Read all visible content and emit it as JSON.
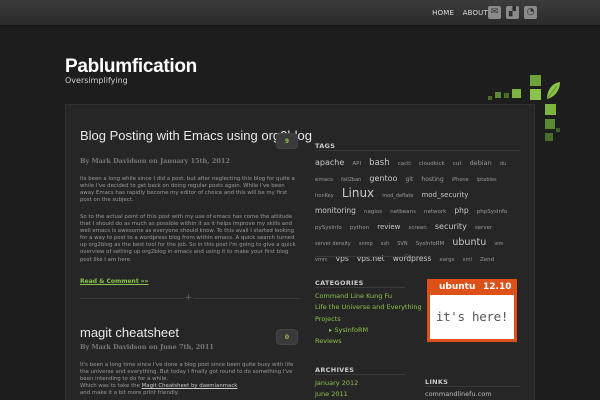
{
  "nav": {
    "home": "HOME",
    "about": "ABOUT"
  },
  "site": {
    "title": "Pablumfication",
    "tagline": "Oversimplifying"
  },
  "posts": [
    {
      "title": "Blog Posting with Emacs using org2blog",
      "meta": "By Mark Davidson on January 15th, 2012",
      "comments": "9",
      "paragraphs": [
        "Its been a long while since I did a post, but after neglecting this blog for quite a while I've decided to get back on doing regular posts again. While I've been away Emacs has rapidly become my editor of choice and this will be my first post on the subject.",
        "So to the actual point of this post with my use of emacs has come the attitude that I should do as much as possible within it as it helps improve my skills and well emacs is awesome as everyone should know. To this avail I started looking for a way to post to a wordpress blog from within emacs. A quick search turned up org2blog as the best tool for the job. So in this post I'm going to give a quick overview of setting up org2blog in emacs and using it to make your first blog post like I am here."
      ],
      "read_more": "Read & Comment »»"
    },
    {
      "title": "magit cheatsheet",
      "meta": "By Mark Davidson on June 7th, 2011",
      "comments": "0",
      "paragraph": "It's been a long time since I've done a blog post since been quite busy with life the universe and everything. But today I finally got round to do something I've been intending to do for a while.",
      "line2_prefix": "Which was to take the ",
      "line2_link": "Magit Cheatsheet by daemianmack",
      "line3": "and make it a bit more print friendly."
    }
  ],
  "sidebar": {
    "tags_heading": "TAGS",
    "tags": [
      {
        "t": "apache",
        "s": 8
      },
      {
        "t": "API",
        "s": 5.5
      },
      {
        "t": "bash",
        "s": 8.5
      },
      {
        "t": "cacti",
        "s": 5.5
      },
      {
        "t": "cloudkick",
        "s": 5.5
      },
      {
        "t": "cut",
        "s": 5.5
      },
      {
        "t": "debian",
        "s": 6.5
      },
      {
        "t": "du",
        "s": 5
      },
      {
        "t": "emacs",
        "s": 5.5
      },
      {
        "t": "fail2ban",
        "s": 5
      },
      {
        "t": "gentoo",
        "s": 8
      },
      {
        "t": "git",
        "s": 6
      },
      {
        "t": "hosting",
        "s": 6
      },
      {
        "t": "iPhone",
        "s": 5
      },
      {
        "t": "iptables",
        "s": 5
      },
      {
        "t": "IronKey",
        "s": 5
      },
      {
        "t": "Linux",
        "s": 12
      },
      {
        "t": "mod_deflate",
        "s": 5
      },
      {
        "t": "mod_security",
        "s": 7
      },
      {
        "t": "monitoring",
        "s": 7.5
      },
      {
        "t": "nagios",
        "s": 5.5
      },
      {
        "t": "netbeans",
        "s": 5.5
      },
      {
        "t": "network",
        "s": 5.5
      },
      {
        "t": "php",
        "s": 7.5
      },
      {
        "t": "phpSysInfo",
        "s": 5.5
      },
      {
        "t": "pySysInfo",
        "s": 5.5
      },
      {
        "t": "python",
        "s": 5.5
      },
      {
        "t": "review",
        "s": 7
      },
      {
        "t": "screen",
        "s": 5.5
      },
      {
        "t": "security",
        "s": 8
      },
      {
        "t": "server",
        "s": 5.5
      },
      {
        "t": "server density",
        "s": 5
      },
      {
        "t": "snmp",
        "s": 5
      },
      {
        "t": "ssh",
        "s": 5
      },
      {
        "t": "SVN",
        "s": 5
      },
      {
        "t": "SysInfoRM",
        "s": 5.5
      },
      {
        "t": "ubuntu",
        "s": 9.5
      },
      {
        "t": "vim",
        "s": 5
      },
      {
        "t": "vmrc",
        "s": 5
      },
      {
        "t": "vps",
        "s": 7.5
      },
      {
        "t": "vps.net",
        "s": 7.5
      },
      {
        "t": "wordpress",
        "s": 7.5
      },
      {
        "t": "xargs",
        "s": 5.5
      },
      {
        "t": "xml",
        "s": 5
      },
      {
        "t": "Zend",
        "s": 5.5
      }
    ],
    "categories_heading": "CATEGORIES",
    "categories": [
      {
        "label": "Command Line Kung Fu"
      },
      {
        "label": "Life the Universe and Everything"
      },
      {
        "label": "Projects"
      },
      {
        "label": "SysInfoRM",
        "sub": true
      },
      {
        "label": "Reviews"
      }
    ],
    "archives_heading": "ARCHIVES",
    "archives": [
      "January 2012",
      "June 2011"
    ],
    "links_heading": "LINKS",
    "links": [
      "commandlinefu.com"
    ],
    "ubuntu_badge": {
      "brand": "ubuntu",
      "version": "12.10",
      "message": "it's here!"
    }
  },
  "colors": {
    "accent": "#8bc34a",
    "background": "#1d1d1d",
    "panel": "#262626",
    "ubuntu": "#dd5119"
  },
  "icons": [
    "email-icon",
    "delicious-icon",
    "rss-icon",
    "leaf-icon",
    "plus-icon"
  ]
}
